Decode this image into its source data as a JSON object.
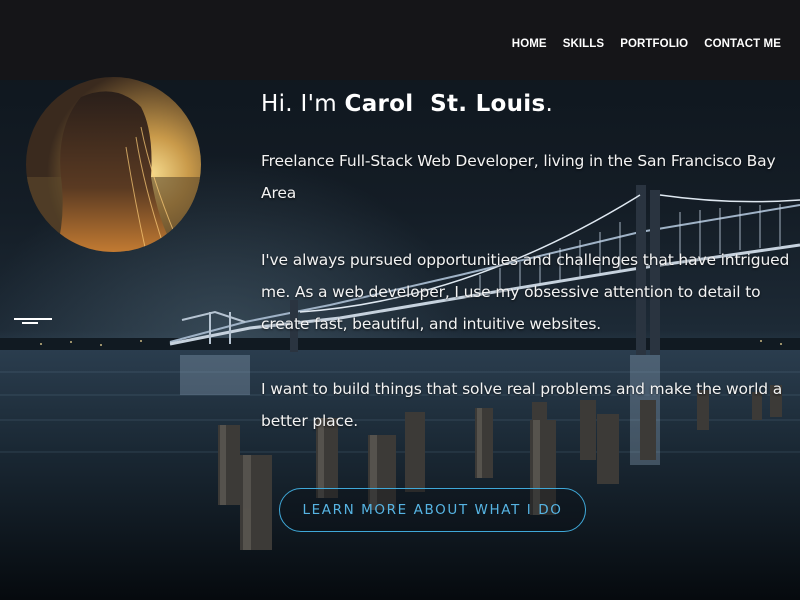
{
  "nav": {
    "items": [
      {
        "label": "HOME"
      },
      {
        "label": "SKILLS"
      },
      {
        "label": "PORTFOLIO"
      },
      {
        "label": "CONTACT ME"
      }
    ]
  },
  "hero": {
    "greeting": "Hi. I'm ",
    "name": "Carol  St. Louis",
    "name_suffix": ".",
    "tagline": "Freelance Full-Stack Web Developer, living in the San Francisco Bay Area",
    "paragraph_1": "I've always pursued opportunities and challenges that have intrigued me. As a web developer, I use my obsessive attention to detail to create fast, beautiful, and intuitive websites.",
    "paragraph_2": "I want to build things that solve real problems and make the world a better place.",
    "cta_label": "LEARN MORE ABOUT WHAT I DO"
  },
  "colors": {
    "navbar_bg": "#161618",
    "accent": "#56b4e3",
    "text": "#ffffff"
  },
  "icons": {
    "background": "bay-bridge-night-photo",
    "avatar": "profile-photo"
  }
}
